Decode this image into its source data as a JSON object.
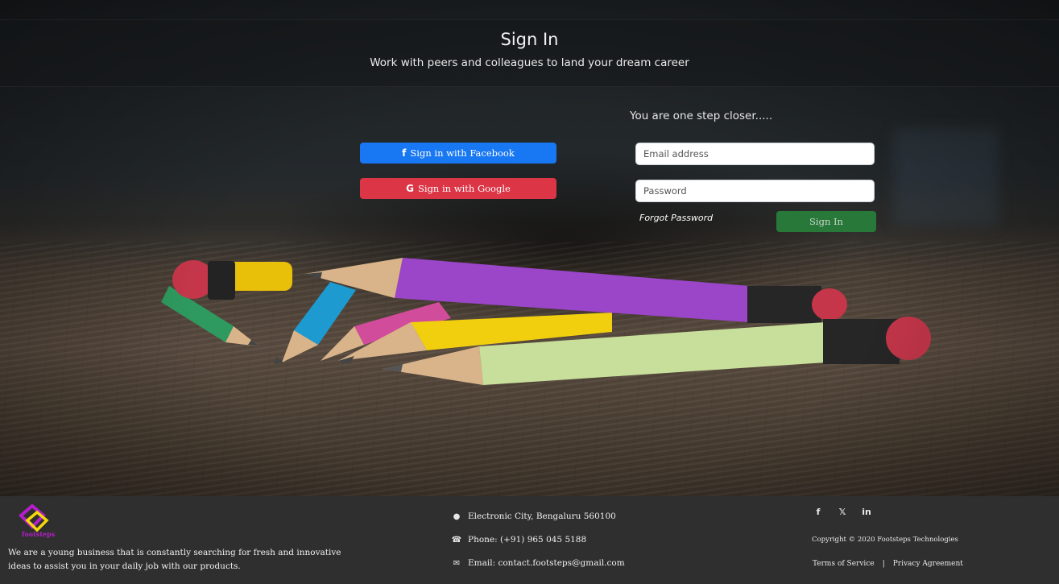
{
  "header": {
    "title": "Sign In",
    "subtitle": "Work with peers and colleagues to land your dream career"
  },
  "auth": {
    "tagline": "You are one step closer.....",
    "facebook_label": "Sign in with Facebook",
    "google_label": "Sign in with Google",
    "email_placeholder": "Email address",
    "password_placeholder": "Password",
    "forgot_label": "Forgot Password",
    "signin_label": "Sign In"
  },
  "footer": {
    "brand": "footsteps",
    "about": "We are a young business that is constantly searching for fresh and innovative ideas to assist you in your daily job with our products.",
    "address": "Electronic City, Bengaluru 560100",
    "phone": "Phone: (+91) 965 045 5188",
    "email": "Email: contact.footsteps@gmail.com",
    "social_icons": [
      "facebook-icon",
      "twitter-icon",
      "linkedin-icon"
    ],
    "copyright": "Copyright © 2020 Footsteps Technologies",
    "terms_label": "Terms of Service",
    "privacy_label": "Privacy Agreement",
    "separator": "|"
  },
  "colors": {
    "facebook": "#1877f2",
    "google": "#dc3545",
    "signin": "#28783a",
    "footer_bg": "#2f2f2f",
    "brand_purple": "#b41fc9",
    "brand_yellow": "#f5d90a"
  }
}
